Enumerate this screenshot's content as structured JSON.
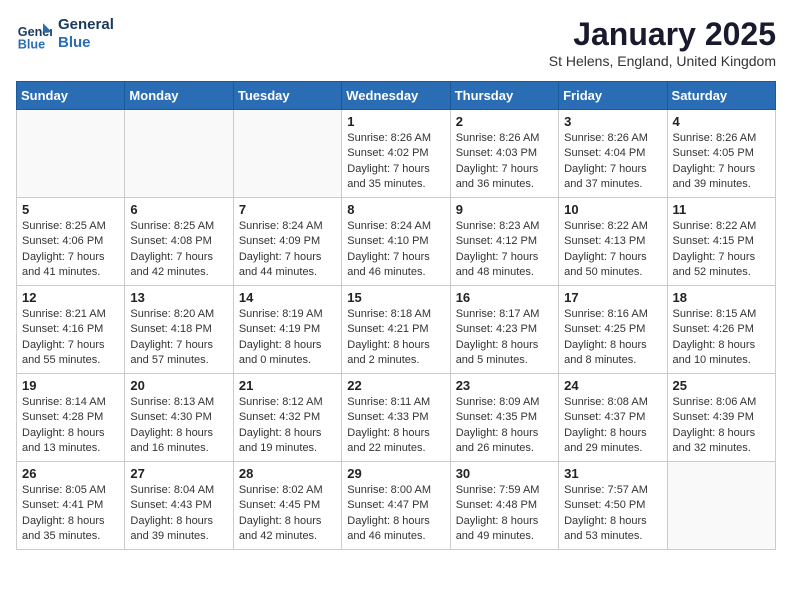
{
  "header": {
    "logo_line1": "General",
    "logo_line2": "Blue",
    "month": "January 2025",
    "location": "St Helens, England, United Kingdom"
  },
  "weekdays": [
    "Sunday",
    "Monday",
    "Tuesday",
    "Wednesday",
    "Thursday",
    "Friday",
    "Saturday"
  ],
  "weeks": [
    [
      {
        "day": "",
        "info": ""
      },
      {
        "day": "",
        "info": ""
      },
      {
        "day": "",
        "info": ""
      },
      {
        "day": "1",
        "info": "Sunrise: 8:26 AM\nSunset: 4:02 PM\nDaylight: 7 hours and 35 minutes."
      },
      {
        "day": "2",
        "info": "Sunrise: 8:26 AM\nSunset: 4:03 PM\nDaylight: 7 hours and 36 minutes."
      },
      {
        "day": "3",
        "info": "Sunrise: 8:26 AM\nSunset: 4:04 PM\nDaylight: 7 hours and 37 minutes."
      },
      {
        "day": "4",
        "info": "Sunrise: 8:26 AM\nSunset: 4:05 PM\nDaylight: 7 hours and 39 minutes."
      }
    ],
    [
      {
        "day": "5",
        "info": "Sunrise: 8:25 AM\nSunset: 4:06 PM\nDaylight: 7 hours and 41 minutes."
      },
      {
        "day": "6",
        "info": "Sunrise: 8:25 AM\nSunset: 4:08 PM\nDaylight: 7 hours and 42 minutes."
      },
      {
        "day": "7",
        "info": "Sunrise: 8:24 AM\nSunset: 4:09 PM\nDaylight: 7 hours and 44 minutes."
      },
      {
        "day": "8",
        "info": "Sunrise: 8:24 AM\nSunset: 4:10 PM\nDaylight: 7 hours and 46 minutes."
      },
      {
        "day": "9",
        "info": "Sunrise: 8:23 AM\nSunset: 4:12 PM\nDaylight: 7 hours and 48 minutes."
      },
      {
        "day": "10",
        "info": "Sunrise: 8:22 AM\nSunset: 4:13 PM\nDaylight: 7 hours and 50 minutes."
      },
      {
        "day": "11",
        "info": "Sunrise: 8:22 AM\nSunset: 4:15 PM\nDaylight: 7 hours and 52 minutes."
      }
    ],
    [
      {
        "day": "12",
        "info": "Sunrise: 8:21 AM\nSunset: 4:16 PM\nDaylight: 7 hours and 55 minutes."
      },
      {
        "day": "13",
        "info": "Sunrise: 8:20 AM\nSunset: 4:18 PM\nDaylight: 7 hours and 57 minutes."
      },
      {
        "day": "14",
        "info": "Sunrise: 8:19 AM\nSunset: 4:19 PM\nDaylight: 8 hours and 0 minutes."
      },
      {
        "day": "15",
        "info": "Sunrise: 8:18 AM\nSunset: 4:21 PM\nDaylight: 8 hours and 2 minutes."
      },
      {
        "day": "16",
        "info": "Sunrise: 8:17 AM\nSunset: 4:23 PM\nDaylight: 8 hours and 5 minutes."
      },
      {
        "day": "17",
        "info": "Sunrise: 8:16 AM\nSunset: 4:25 PM\nDaylight: 8 hours and 8 minutes."
      },
      {
        "day": "18",
        "info": "Sunrise: 8:15 AM\nSunset: 4:26 PM\nDaylight: 8 hours and 10 minutes."
      }
    ],
    [
      {
        "day": "19",
        "info": "Sunrise: 8:14 AM\nSunset: 4:28 PM\nDaylight: 8 hours and 13 minutes."
      },
      {
        "day": "20",
        "info": "Sunrise: 8:13 AM\nSunset: 4:30 PM\nDaylight: 8 hours and 16 minutes."
      },
      {
        "day": "21",
        "info": "Sunrise: 8:12 AM\nSunset: 4:32 PM\nDaylight: 8 hours and 19 minutes."
      },
      {
        "day": "22",
        "info": "Sunrise: 8:11 AM\nSunset: 4:33 PM\nDaylight: 8 hours and 22 minutes."
      },
      {
        "day": "23",
        "info": "Sunrise: 8:09 AM\nSunset: 4:35 PM\nDaylight: 8 hours and 26 minutes."
      },
      {
        "day": "24",
        "info": "Sunrise: 8:08 AM\nSunset: 4:37 PM\nDaylight: 8 hours and 29 minutes."
      },
      {
        "day": "25",
        "info": "Sunrise: 8:06 AM\nSunset: 4:39 PM\nDaylight: 8 hours and 32 minutes."
      }
    ],
    [
      {
        "day": "26",
        "info": "Sunrise: 8:05 AM\nSunset: 4:41 PM\nDaylight: 8 hours and 35 minutes."
      },
      {
        "day": "27",
        "info": "Sunrise: 8:04 AM\nSunset: 4:43 PM\nDaylight: 8 hours and 39 minutes."
      },
      {
        "day": "28",
        "info": "Sunrise: 8:02 AM\nSunset: 4:45 PM\nDaylight: 8 hours and 42 minutes."
      },
      {
        "day": "29",
        "info": "Sunrise: 8:00 AM\nSunset: 4:47 PM\nDaylight: 8 hours and 46 minutes."
      },
      {
        "day": "30",
        "info": "Sunrise: 7:59 AM\nSunset: 4:48 PM\nDaylight: 8 hours and 49 minutes."
      },
      {
        "day": "31",
        "info": "Sunrise: 7:57 AM\nSunset: 4:50 PM\nDaylight: 8 hours and 53 minutes."
      },
      {
        "day": "",
        "info": ""
      }
    ]
  ]
}
